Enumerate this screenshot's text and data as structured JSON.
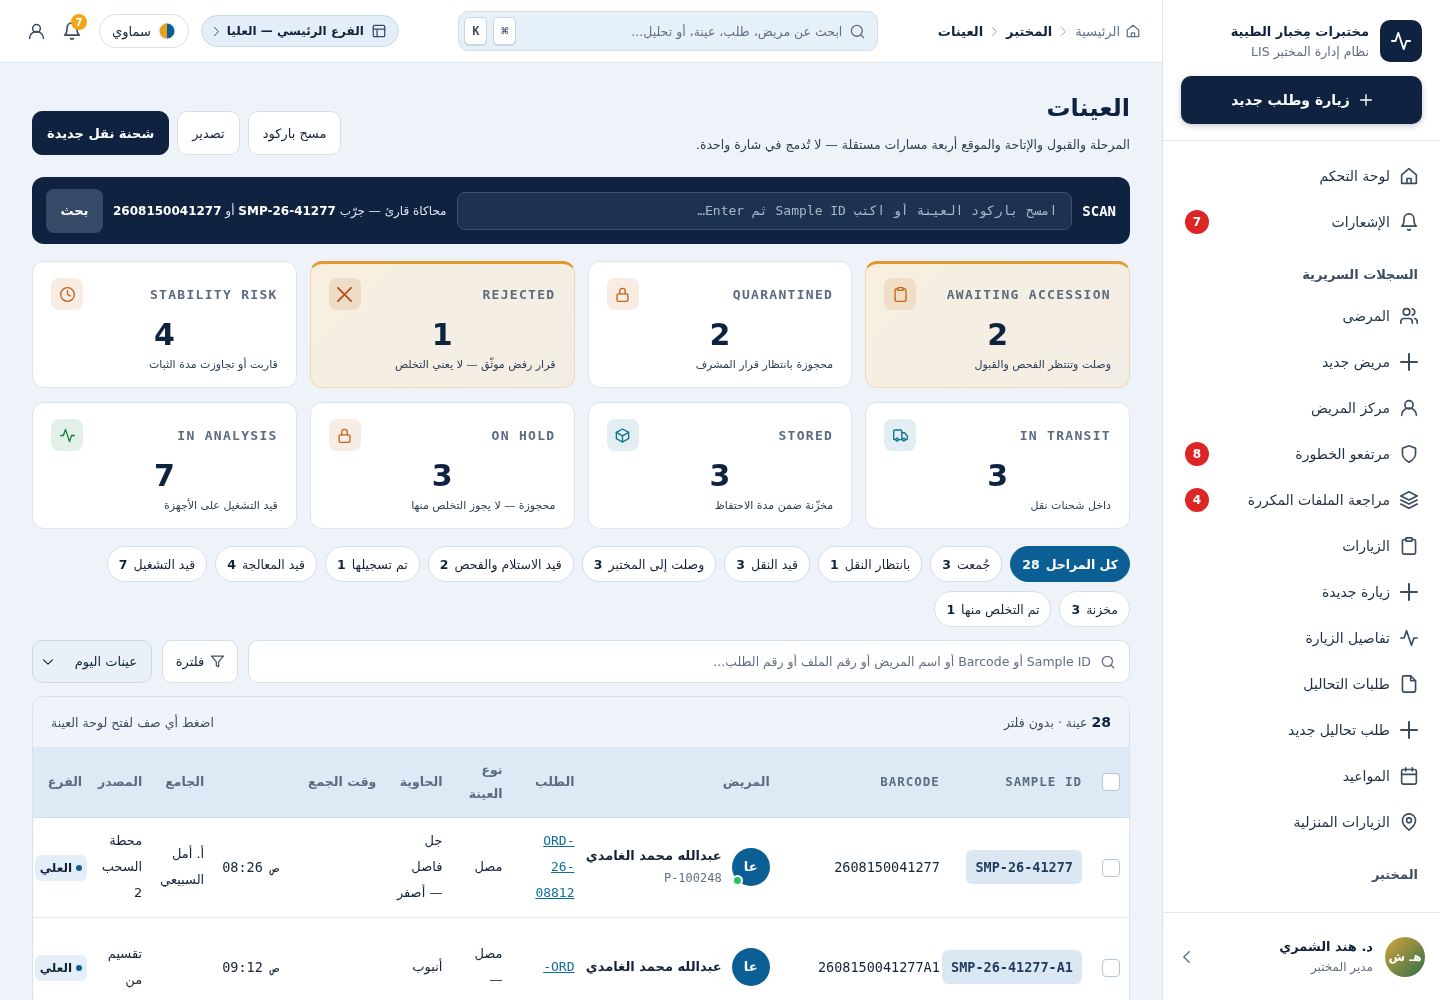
{
  "sidebar": {
    "brand": {
      "name": "مختبرات مِخبار الطبية",
      "tagline": "نظام إدارة المختبر LIS"
    },
    "new_button": "زيارة وطلب جديد",
    "sections": [
      {
        "items": [
          {
            "label": "لوحة التحكم",
            "selected": false
          },
          {
            "label": "الإشعارات",
            "badge": "7",
            "selected": false
          }
        ]
      },
      {
        "heading": "السجلات السريرية",
        "items": [
          {
            "label": "المرضى",
            "selected": false
          },
          {
            "label": "مريض جديد",
            "selected": false
          },
          {
            "label": "مركز المريض",
            "selected": false
          },
          {
            "label": "مرتفعو الخطورة",
            "badge": "8",
            "selected": false
          },
          {
            "label": "مراجعة الملفات المكررة",
            "badge": "4",
            "selected": false
          },
          {
            "label": "الزيارات",
            "selected": false
          },
          {
            "label": "زيارة جديدة",
            "selected": false
          },
          {
            "label": "تفاصيل الزيارة",
            "selected": false
          },
          {
            "label": "طلبات التحاليل",
            "selected": false
          },
          {
            "label": "طلب تحاليل جديد",
            "selected": false
          },
          {
            "label": "المواعيد",
            "selected": false
          },
          {
            "label": "الزيارات المنزلية",
            "selected": false
          }
        ]
      },
      {
        "heading": "المختبر"
      }
    ],
    "user": {
      "initials": "هـ ش",
      "name": "د. هند الشمري",
      "role": "مدير المختبر"
    }
  },
  "header": {
    "breadcrumb": [
      "الرئيسية",
      "المختبر",
      "العينات"
    ],
    "search": {
      "placeholder": "ابحث عن مريض، طلب، عينة، أو تحليل...",
      "keys": [
        "⌘",
        "K"
      ]
    },
    "branch": "الفرع الرئيسي — العليا",
    "theme": "سماوي",
    "notifications": "7"
  },
  "page": {
    "title": "العينات",
    "subtitle": "المرحلة والقبول والإتاحة والموقع أربعة مسارات مستقلة — لا تُدمج في شارة واحدة.",
    "actions": [
      {
        "label": "مسح باركود",
        "kind": "secondary"
      },
      {
        "label": "تصدير",
        "kind": "secondary"
      },
      {
        "label": "شحنة نقل جديدة",
        "kind": "primary"
      }
    ]
  },
  "scan": {
    "label": "SCAN",
    "placeholder": "امسح باركود العينة أو اكتب Sample ID ثم Enter…",
    "hint": "محاكاة قارئ — جرّب **SMP-26-41277** أو **2608150041277**",
    "button": "بحث"
  },
  "stat_cards": [
    {
      "label": "AWAITING ACCESSION",
      "value": "2",
      "description": "وصلت وتنتظر الفحص والقبول",
      "flagged": true,
      "color": "#c2651a"
    },
    {
      "label": "QUARANTINED",
      "value": "2",
      "description": "محجوزة بانتظار قرار المشرف",
      "flagged": false,
      "color": "#c2651a"
    },
    {
      "label": "REJECTED",
      "value": "1",
      "description": "قرار رفض موثّق — لا يعني التخلص",
      "flagged": true,
      "color": "#b4531a"
    },
    {
      "label": "STABILITY RISK",
      "value": "4",
      "description": "قاربت أو تجاوزت مدة الثبات",
      "flagged": false,
      "color": "#c2651a"
    },
    {
      "label": "IN TRANSIT",
      "value": "3",
      "description": "داخل شحنات نقل",
      "flagged": false,
      "color": "#0e7490"
    },
    {
      "label": "STORED",
      "value": "3",
      "description": "مخزّنة ضمن مدة الاحتفاظ",
      "flagged": false,
      "color": "#0e7490"
    },
    {
      "label": "ON HOLD",
      "value": "3",
      "description": "محجوزة — لا يجوز التخلص منها",
      "flagged": false,
      "color": "#c2651a"
    },
    {
      "label": "IN ANALYSIS",
      "value": "7",
      "description": "قيد التشغيل على الأجهزة",
      "flagged": false,
      "color": "#15803d"
    }
  ],
  "stage_filters": [
    {
      "label": "كل المراحل",
      "count": "28",
      "selected": true
    },
    {
      "label": "جُمعت",
      "count": "3",
      "selected": false
    },
    {
      "label": "بانتظار النقل",
      "count": "1",
      "selected": false
    },
    {
      "label": "قيد النقل",
      "count": "3",
      "selected": false
    },
    {
      "label": "وصلت إلى المختبر",
      "count": "3",
      "selected": false
    },
    {
      "label": "قيد الاستلام والفحص",
      "count": "2",
      "selected": false
    },
    {
      "label": "تم تسجيلها",
      "count": "1",
      "selected": false
    },
    {
      "label": "قيد المعالجة",
      "count": "4",
      "selected": false
    },
    {
      "label": "قيد التشغيل",
      "count": "7",
      "selected": false
    },
    {
      "label": "مخزنة",
      "count": "3",
      "selected": false
    },
    {
      "label": "تم التخلص منها",
      "count": "1",
      "selected": false
    }
  ],
  "toolbar": {
    "search": {
      "placeholder": "Sample ID أو Barcode أو اسم المريض أو رقم الملف أو رقم الطلب..."
    },
    "filter_button": "فلترة",
    "view": "عينات اليوم"
  },
  "table": {
    "summary": "**28** عينة · بدون فلتر",
    "hint": "اضغط أي صف لفتح لوحة العينة",
    "select_all": false,
    "columns": [
      {
        "label": "SAMPLE ID",
        "kind": "code"
      },
      {
        "label": "BARCODE",
        "kind": "code"
      },
      {
        "label": "المريض",
        "kind": "text"
      },
      {
        "label": "الطلب",
        "kind": "text"
      },
      {
        "label": "نوع العينة",
        "kind": "text"
      },
      {
        "label": "الحاوية",
        "kind": "text"
      },
      {
        "label": "وقت الجمع",
        "kind": "text"
      },
      {
        "label": "الجامع",
        "kind": "text"
      },
      {
        "label": "المصدر",
        "kind": "text"
      },
      {
        "label": "الفرع",
        "kind": "text"
      }
    ],
    "rows": [
      {
        "checked": false,
        "sample_id": "SMP-26-41277",
        "barcode": "2608150041277",
        "patient": {
          "initials": "عا",
          "name": "عبدالله محمد الغامدي",
          "file": "P-100248",
          "color": "#22c55e"
        },
        "order": "ORD-26-08812",
        "sample_type": "مصل",
        "container": "جل فاصل — أصفر",
        "time": "08:26 ص",
        "collector": "أ. أمل السبيعي",
        "source": "محطة السحب 2",
        "branch": "العلي"
      },
      {
        "checked": false,
        "sample_id": "SMP-26-41277-A1",
        "barcode": "2608150041277A1",
        "patient": {
          "initials": "عا",
          "name": "عبدالله محمد الغامدي"
        },
        "order": "ORD-",
        "sample_type": "مصل —",
        "container": "أنبوب",
        "time": "09:12 ص",
        "source": "تقسيم من",
        "branch": "العلي"
      }
    ]
  }
}
